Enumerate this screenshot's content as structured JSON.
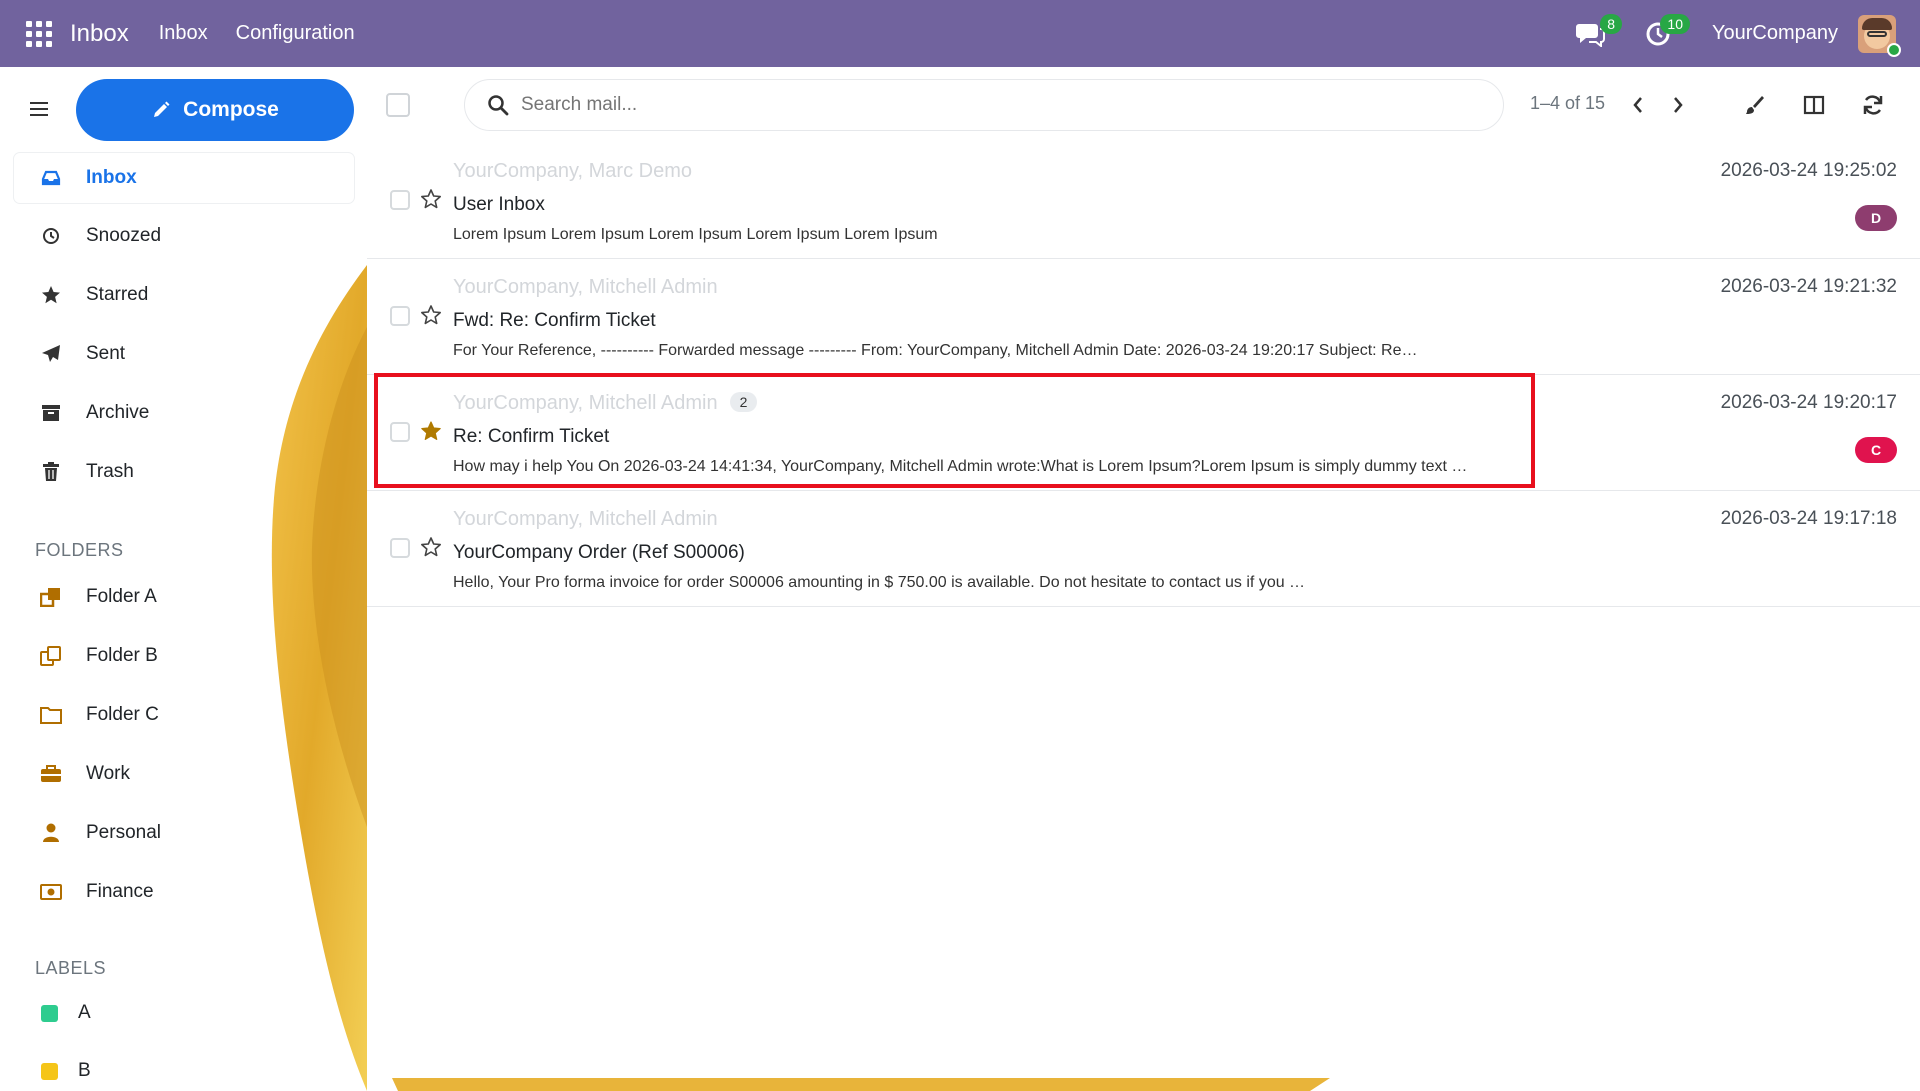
{
  "topbar": {
    "brand": "Inbox",
    "menu": [
      "Inbox",
      "Configuration"
    ],
    "chat_count": "8",
    "activity_count": "10",
    "company": "YourCompany",
    "color": "#71639e"
  },
  "sidebar": {
    "compose_label": "Compose",
    "items": [
      {
        "label": "Inbox",
        "icon": "inbox-icon"
      },
      {
        "label": "Snoozed",
        "icon": "clock-icon"
      },
      {
        "label": "Starred",
        "icon": "star-icon"
      },
      {
        "label": "Sent",
        "icon": "paper-plane-icon"
      },
      {
        "label": "Archive",
        "icon": "archive-icon"
      },
      {
        "label": "Trash",
        "icon": "trash-icon"
      }
    ],
    "folders_title": "FOLDERS",
    "folders": [
      {
        "label": "Folder A",
        "icon": "folder-clone-icon"
      },
      {
        "label": "Folder B",
        "icon": "folder-copy-icon"
      },
      {
        "label": "Folder C",
        "icon": "folder-icon"
      },
      {
        "label": "Work",
        "icon": "briefcase-icon"
      },
      {
        "label": "Personal",
        "icon": "user-icon"
      },
      {
        "label": "Finance",
        "icon": "money-icon"
      }
    ],
    "labels_title": "LABELS",
    "labels": [
      {
        "label": "A",
        "color": "#2ecc8f"
      },
      {
        "label": "B",
        "color": "#f5c518"
      }
    ]
  },
  "toolbar": {
    "search_placeholder": "Search mail...",
    "pager": "1–4 of 15"
  },
  "messages": [
    {
      "from": "YourCompany, Marc Demo",
      "subject": "User Inbox",
      "preview": "Lorem Ipsum Lorem Ipsum Lorem Ipsum Lorem Ipsum Lorem Ipsum",
      "date": "2026-03-24 19:25:02",
      "starred": false,
      "count": "",
      "tag": "D",
      "tag_color": "#8e3d6f"
    },
    {
      "from": "YourCompany, Mitchell Admin",
      "subject": "Fwd: Re: Confirm Ticket",
      "preview": "For Your Reference, ---------- Forwarded message --------- From: YourCompany, Mitchell Admin Date: 2026-03-24 19:20:17 Subject: Re…",
      "date": "2026-03-24 19:21:32",
      "starred": false,
      "count": "",
      "tag": "",
      "tag_color": ""
    },
    {
      "from": "YourCompany, Mitchell Admin",
      "subject": "Re: Confirm Ticket",
      "preview": "How may i help You On 2026-03-24 14:41:34, YourCompany, Mitchell Admin wrote:What is Lorem Ipsum?Lorem Ipsum is simply dummy text …",
      "date": "2026-03-24 19:20:17",
      "starred": true,
      "count": "2",
      "tag": "C",
      "tag_color": "#e0134e"
    },
    {
      "from": "YourCompany, Mitchell Admin",
      "subject": "YourCompany Order (Ref S00006)",
      "preview": "Hello, Your Pro forma invoice for order S00006 amounting in $ 750.00 is available. Do not hesitate to contact us if you …",
      "date": "2026-03-24 19:17:18",
      "starred": false,
      "count": "",
      "tag": "",
      "tag_color": ""
    }
  ]
}
